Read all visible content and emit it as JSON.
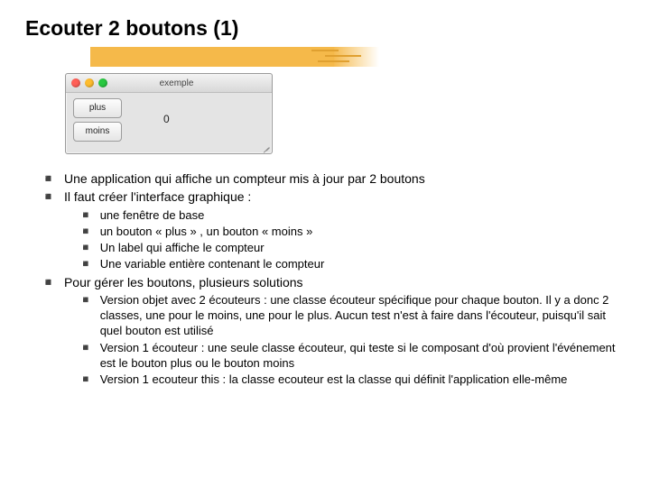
{
  "title": "Ecouter 2 boutons (1)",
  "screenshot": {
    "window_title": "exemple",
    "button_plus": "plus",
    "button_moins": "moins",
    "counter": "0"
  },
  "bullets": [
    {
      "text": "Une application qui affiche un compteur mis à jour par 2 boutons"
    },
    {
      "text": "Il faut créer l'interface graphique :",
      "children": [
        "une fenêtre de base",
        "un bouton « plus » , un bouton « moins »",
        "Un label qui affiche le compteur",
        "Une variable entière contenant le compteur"
      ]
    },
    {
      "text": "Pour gérer les boutons, plusieurs solutions",
      "children": [
        "Version objet avec 2 écouteurs :  une classe écouteur spécifique pour chaque bouton. Il y a donc 2 classes, une pour le moins, une pour le plus. Aucun test n'est à faire dans l'écouteur, puisqu'il sait quel bouton est utilisé",
        "Version 1 écouteur : une seule classe écouteur, qui teste si le composant d'où provient l'événement est le bouton plus ou le bouton moins",
        "Version 1 ecouteur this : la classe ecouteur est la classe qui définit l'application elle-même"
      ]
    }
  ]
}
